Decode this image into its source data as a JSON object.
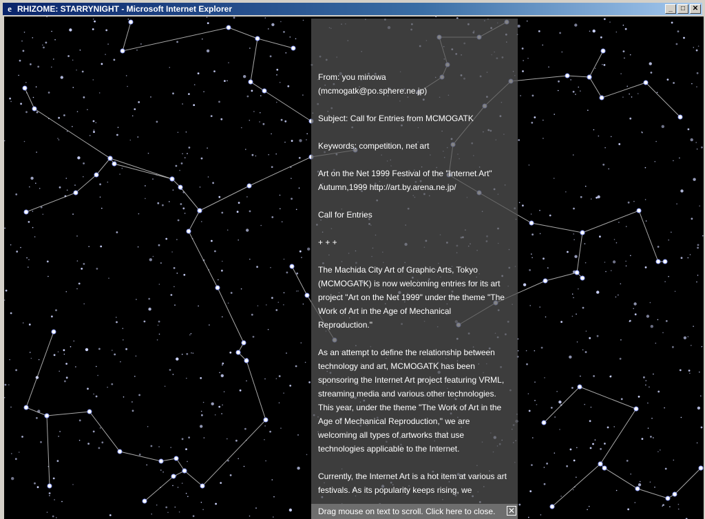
{
  "window": {
    "title": "RHIZOME: STARRYNIGHT - Microsoft Internet Explorer",
    "icon": "ie-logo-icon",
    "buttons": {
      "minimize": "_",
      "maximize": "□",
      "close": "✕"
    }
  },
  "message": {
    "from_line": "From: you minowa",
    "email": "(mcmogatk@po.sphere.ne.jp)",
    "subject": "Subject: Call for Entries from MCMOGATK",
    "keywords": "Keywords: competition, net art",
    "festival_line1": "Art on the Net 1999 Festival of the \"Internet Art\"",
    "festival_line2": "Autumn,1999 http://art.by.arena.ne.jp/",
    "call": "Call for Entries",
    "separator": "+ + +",
    "para1": "The Machida City Art of Graphic Arts, Tokyo (MCMOGATK) is now welcoming entries for its art project \"Art on the Net 1999\" under the theme \"The Work of Art in the Age of Mechanical Reproduction.\"",
    "para2": "As an attempt to define the relationship between technology and art, MCMOGATK has been sponsoring the Internet Art project featuring VRML, streaming media and various other technologies. This year, under the theme \"The Work of Art in the Age of Mechanical Reproduction,\" we are welcoming all types of artworks that use technologies applicable to the Internet.",
    "para3": "Currently, the Internet Art is a hot item at various art festivals. As its popularity keeps rising, we"
  },
  "footer": {
    "hint": "Drag mouse on text to scroll. Click here to close.",
    "close_symbol": "✕"
  },
  "colors": {
    "sky": "#000000",
    "star": "#cfd6ff",
    "line": "#c8c8c8",
    "title_start": "#0a246a",
    "title_end": "#a6caf0"
  }
}
